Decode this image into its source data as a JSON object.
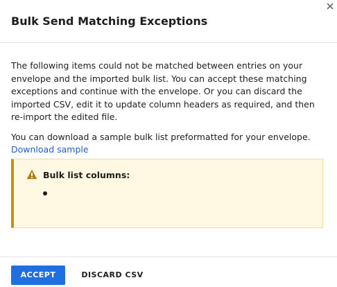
{
  "dialog": {
    "title": "Bulk Send Matching Exceptions",
    "close_icon": "close-icon"
  },
  "body": {
    "paragraph1": "The following items could not be matched between entries on your envelope and the imported bulk list. You can accept these matching exceptions and continue with the envelope. Or you can discard the imported CSV, edit it to update column headers as required, and then re-import the edited file.",
    "paragraph2": "You can download a sample bulk list preformatted for your envelope.",
    "download_link": "Download sample"
  },
  "callout": {
    "icon": "warning-icon",
    "title": "Bulk list columns:",
    "items": [
      ""
    ],
    "colors": {
      "background": "#fff9e3",
      "border": "#f2dc9a",
      "accent": "#c9900e"
    }
  },
  "footer": {
    "accept_label": "ACCEPT",
    "discard_label": "DISCARD CSV"
  },
  "colors": {
    "primary": "#1f6fe0",
    "link": "#1f5fbf",
    "text": "#1e1e1e"
  }
}
